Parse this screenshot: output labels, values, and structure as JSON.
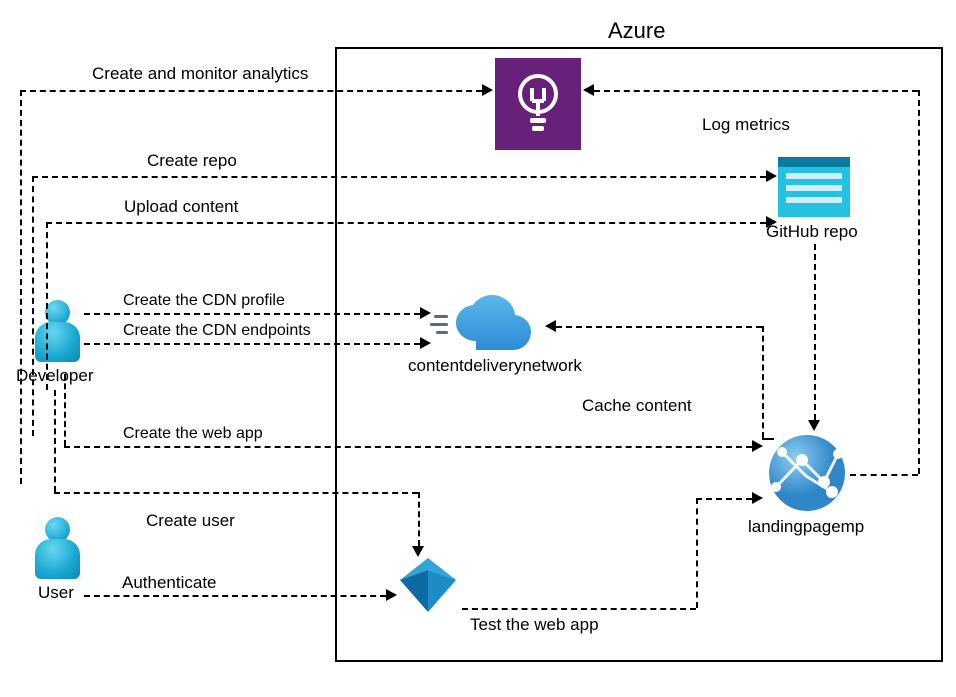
{
  "container": {
    "title": "Azure"
  },
  "actors": {
    "developer": "Developer",
    "user": "User"
  },
  "nodes": {
    "insights_icon": "application-insights-icon",
    "githubrepo": "GitHub repo",
    "cdn": "contentdeliverynetwork",
    "webapp": "landingpagemp",
    "aad_icon": "azure-ad-icon"
  },
  "flows": {
    "create_monitor": "Create and monitor analytics",
    "log_metrics": "Log metrics",
    "create_repo": "Create repo",
    "upload_content": "Upload content",
    "create_cdn_profile": "Create the CDN profile",
    "create_cdn_endpoints": "Create the CDN endpoints",
    "cache_content": "Cache content",
    "create_web_app": "Create the web app",
    "create_user": "Create user",
    "authenticate": "Authenticate",
    "test_web_app": "Test the web app"
  },
  "chart_data": {
    "type": "diagram",
    "title": "Azure",
    "actors": [
      "Developer",
      "User"
    ],
    "nodes": [
      "Application Insights",
      "GitHub repo",
      "contentdeliverynetwork",
      "landingpagemp",
      "Azure AD"
    ],
    "edges": [
      {
        "from": "Developer",
        "to": "Application Insights",
        "label": "Create and monitor analytics"
      },
      {
        "from": "landingpagemp",
        "to": "Application Insights",
        "label": "Log metrics"
      },
      {
        "from": "Developer",
        "to": "GitHub repo",
        "label": "Create repo"
      },
      {
        "from": "Developer",
        "to": "GitHub repo",
        "label": "Upload content"
      },
      {
        "from": "Developer",
        "to": "contentdeliverynetwork",
        "label": "Create the CDN profile"
      },
      {
        "from": "Developer",
        "to": "contentdeliverynetwork",
        "label": "Create the CDN endpoints"
      },
      {
        "from": "landingpagemp",
        "to": "contentdeliverynetwork",
        "label": "Cache content"
      },
      {
        "from": "Developer",
        "to": "landingpagemp",
        "label": "Create the web app"
      },
      {
        "from": "GitHub repo",
        "to": "landingpagemp",
        "label": ""
      },
      {
        "from": "Developer",
        "to": "Azure AD",
        "label": "Create user"
      },
      {
        "from": "User",
        "to": "Azure AD",
        "label": "Authenticate"
      },
      {
        "from": "Azure AD",
        "to": "landingpagemp",
        "label": "Test the web app"
      }
    ]
  }
}
